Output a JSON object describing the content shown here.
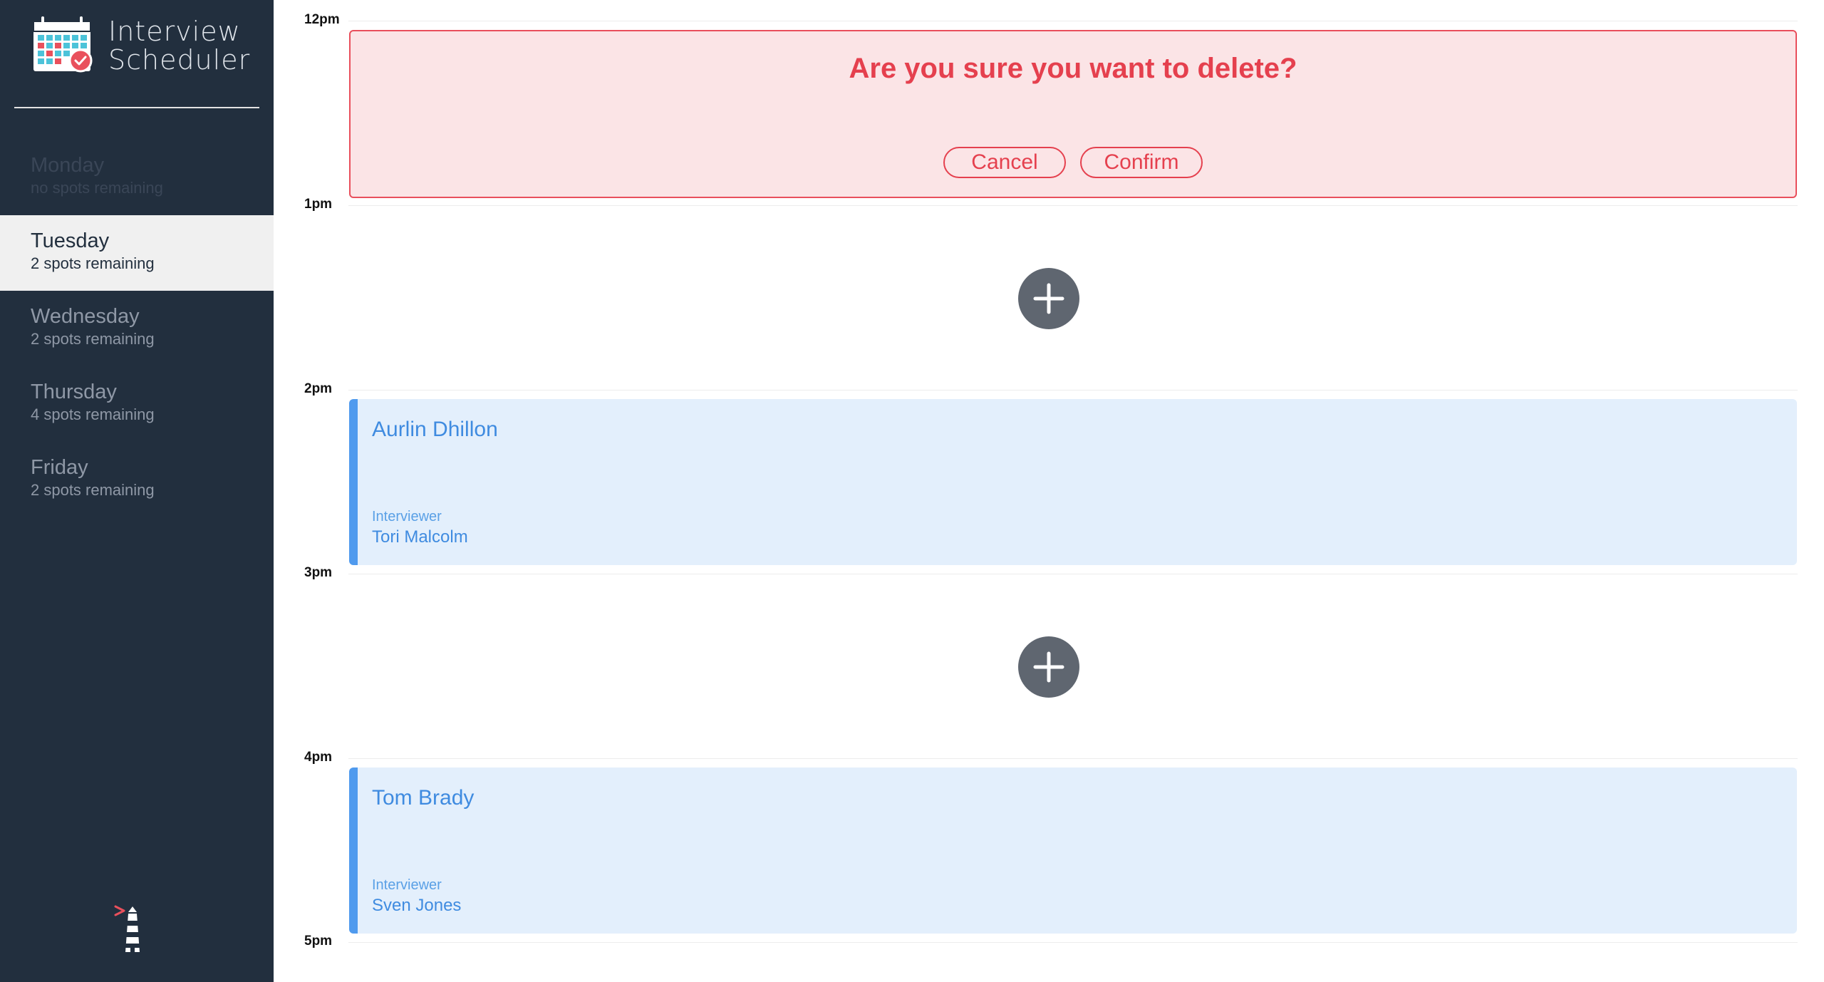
{
  "app": {
    "title_line1": "Interview",
    "title_line2": "Scheduler"
  },
  "days": [
    {
      "name": "Monday",
      "spots": "no spots remaining",
      "state": "full"
    },
    {
      "name": "Tuesday",
      "spots": "2 spots remaining",
      "state": "selected"
    },
    {
      "name": "Wednesday",
      "spots": "2 spots remaining",
      "state": "normal"
    },
    {
      "name": "Thursday",
      "spots": "4 spots remaining",
      "state": "normal"
    },
    {
      "name": "Friday",
      "spots": "2 spots remaining",
      "state": "normal"
    }
  ],
  "times": [
    "12pm",
    "1pm",
    "2pm",
    "3pm",
    "4pm",
    "5pm"
  ],
  "confirm": {
    "message": "Are you sure you want to delete?",
    "cancel_label": "Cancel",
    "confirm_label": "Confirm"
  },
  "appointments": [
    {
      "student": "Aurlin Dhillon",
      "interviewer_label": "Interviewer",
      "interviewer": "Tori Malcolm"
    },
    {
      "student": "Tom Brady",
      "interviewer_label": "Interviewer",
      "interviewer": "Sven Jones"
    }
  ],
  "colors": {
    "sidebar_bg": "#222f3e",
    "danger": "#e5404e",
    "danger_bg": "#fbe4e6",
    "appointment_accent": "#4f9aee",
    "appointment_bg": "#e3effc",
    "add_button": "#5f6670"
  },
  "icons": {
    "logo": "calendar-check-icon",
    "add": "plus-circle-icon",
    "footer": "lighthouse-icon"
  }
}
